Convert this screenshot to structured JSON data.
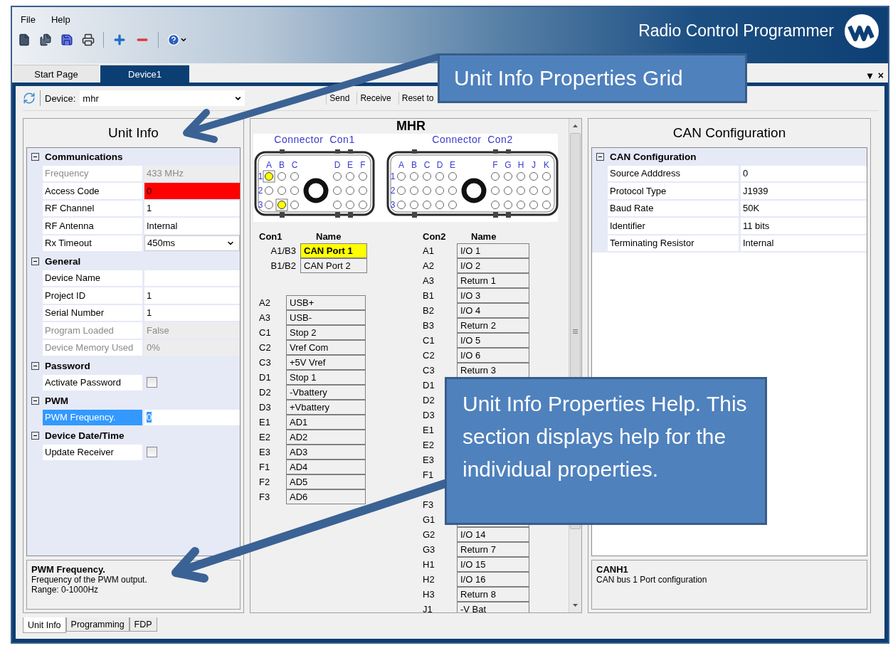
{
  "menu": [
    {
      "label": "File"
    },
    {
      "label": "Help"
    }
  ],
  "app_title": "Radio Control Programmer",
  "document_tabs": [
    {
      "label": "Start Page",
      "selected": false
    },
    {
      "label": "Device1",
      "selected": true
    }
  ],
  "tab_controls": [
    "▾",
    "×"
  ],
  "device_toolbar": {
    "label": "Device:",
    "value": "mhr",
    "buttons": [
      "Send",
      "Receive",
      "Reset to"
    ]
  },
  "unit_info": {
    "title": "Unit Info",
    "sections": [
      {
        "title": "Communications",
        "expanded": true,
        "items": [
          {
            "label": "Frequency",
            "value": "433 MHz",
            "kind": "text",
            "disabled": true,
            "error": false,
            "selected": false
          },
          {
            "label": "Access Code",
            "value": "0",
            "kind": "text",
            "disabled": false,
            "error": true,
            "selected": false
          },
          {
            "label": "RF Channel",
            "value": "1",
            "kind": "text",
            "disabled": false,
            "error": false,
            "selected": false
          },
          {
            "label": "RF Antenna",
            "value": "Internal",
            "kind": "text",
            "disabled": false,
            "error": false,
            "selected": false
          },
          {
            "label": "Rx Timeout",
            "value": "450ms",
            "kind": "dropdown",
            "disabled": false,
            "error": false,
            "selected": false
          }
        ]
      },
      {
        "title": "General",
        "expanded": true,
        "items": [
          {
            "label": "Device Name",
            "kind": "text",
            "disabled": false,
            "error": false,
            "selected": false
          },
          {
            "label": "Project ID",
            "value": "1",
            "kind": "text",
            "disabled": false,
            "error": false,
            "selected": false
          },
          {
            "label": "Serial Number",
            "value": "1",
            "kind": "text",
            "disabled": false,
            "error": false,
            "selected": false
          },
          {
            "label": "Program Loaded",
            "value": "False",
            "kind": "text",
            "disabled": true,
            "error": false,
            "selected": false
          },
          {
            "label": "Device Memory Used",
            "value": "0%",
            "kind": "text",
            "disabled": true,
            "error": false,
            "selected": false
          }
        ]
      },
      {
        "title": "Password",
        "expanded": true,
        "items": [
          {
            "label": "Activate Password",
            "kind": "checkbox",
            "checked": false,
            "disabled": false,
            "error": false,
            "selected": false
          }
        ]
      },
      {
        "title": "PWM",
        "expanded": true,
        "items": [
          {
            "label": "PWM Frequency.",
            "value": "0",
            "kind": "text",
            "disabled": false,
            "error": false,
            "selected": true
          }
        ]
      },
      {
        "title": "Device Date/Time",
        "expanded": true,
        "items": [
          {
            "label": "Update Receiver",
            "kind": "checkbox",
            "checked": false,
            "disabled": false,
            "error": false,
            "selected": false
          }
        ]
      }
    ],
    "help": {
      "title": "PWM Frequency.",
      "lines": [
        "Frequency of the PWM output.",
        "Range: 0-1000Hz"
      ]
    }
  },
  "mhr": {
    "title": "MHR",
    "connectors": [
      {
        "title": "Connector  Con1",
        "columns_left": [
          "A",
          "B",
          "C"
        ],
        "columns_right": [
          "D",
          "E",
          "F"
        ],
        "rows": [
          {
            "label": "1",
            "pins": [
              true,
              false,
              false,
              false,
              false,
              false
            ]
          },
          {
            "label": "2",
            "pins": [
              false,
              false,
              false,
              false,
              false,
              false
            ]
          },
          {
            "label": "3",
            "pins": [
              false,
              true,
              false,
              false,
              false,
              false
            ]
          }
        ]
      },
      {
        "title": "Connector  Con2",
        "columns_left": [
          "A",
          "B",
          "C",
          "D",
          "E"
        ],
        "columns_right": [
          "F",
          "G",
          "H",
          "J",
          "K"
        ],
        "rows": [
          {
            "label": "1",
            "pins": [
              false,
              false,
              false,
              false,
              false,
              false,
              false,
              false,
              false,
              false
            ]
          },
          {
            "label": "2",
            "pins": [
              false,
              false,
              false,
              false,
              false,
              false,
              false,
              false,
              false,
              false
            ]
          },
          {
            "label": "3",
            "pins": [
              false,
              false,
              false,
              false,
              false,
              false,
              false,
              false,
              false,
              false
            ]
          }
        ]
      }
    ],
    "con1": {
      "headers": [
        "Con1",
        "Name"
      ],
      "groups": [
        [
          {
            "pin": "A1/B3",
            "name": "CAN Port 1",
            "highlighted": true
          },
          {
            "pin": "B1/B2",
            "name": "CAN Port 2",
            "highlighted": false
          }
        ],
        [
          {
            "pin": "A2",
            "name": "USB+",
            "highlighted": false
          },
          {
            "pin": "A3",
            "name": "USB-",
            "highlighted": false
          },
          {
            "pin": "C1",
            "name": "Stop 2",
            "highlighted": false
          },
          {
            "pin": "C2",
            "name": "Vref Com",
            "highlighted": false
          },
          {
            "pin": "C3",
            "name": "+5V Vref",
            "highlighted": false
          },
          {
            "pin": "D1",
            "name": "Stop 1",
            "highlighted": false
          },
          {
            "pin": "D2",
            "name": "-Vbattery",
            "highlighted": false
          },
          {
            "pin": "D3",
            "name": "+Vbattery",
            "highlighted": false
          },
          {
            "pin": "E1",
            "name": "AD1",
            "highlighted": false
          },
          {
            "pin": "E2",
            "name": "AD2",
            "highlighted": false
          },
          {
            "pin": "E3",
            "name": "AD3",
            "highlighted": false
          },
          {
            "pin": "F1",
            "name": "AD4",
            "highlighted": false
          },
          {
            "pin": "F2",
            "name": "AD5",
            "highlighted": false
          },
          {
            "pin": "F3",
            "name": "AD6",
            "highlighted": false
          }
        ]
      ]
    },
    "con2": {
      "headers": [
        "Con2",
        "Name"
      ],
      "rows": [
        {
          "pin": "A1",
          "name": "I/O 1"
        },
        {
          "pin": "A2",
          "name": "I/O 2"
        },
        {
          "pin": "A3",
          "name": "Return 1"
        },
        {
          "pin": "B1",
          "name": "I/O 3"
        },
        {
          "pin": "B2",
          "name": "I/O 4"
        },
        {
          "pin": "B3",
          "name": "Return 2"
        },
        {
          "pin": "C1",
          "name": "I/O 5"
        },
        {
          "pin": "C2",
          "name": "I/O 6"
        },
        {
          "pin": "C3",
          "name": "Return 3"
        },
        {
          "pin": "D1"
        },
        {
          "pin": "D2"
        },
        {
          "pin": "D3"
        },
        {
          "pin": "E1"
        },
        {
          "pin": "E2"
        },
        {
          "pin": "E3"
        },
        {
          "pin": "F1"
        },
        {},
        {
          "pin": "F3"
        },
        {
          "pin": "G1"
        },
        {
          "pin": "G2",
          "name": "I/O 14"
        },
        {
          "pin": "G3",
          "name": "Return 7"
        },
        {
          "pin": "H1",
          "name": "I/O 15"
        },
        {
          "pin": "H2",
          "name": "I/O 16"
        },
        {
          "pin": "H3",
          "name": "Return 8"
        },
        {
          "pin": "J1",
          "name": "-V Bat"
        }
      ]
    }
  },
  "can": {
    "title": "CAN Configuration",
    "sections": [
      {
        "title": "CAN Configuration",
        "expanded": true,
        "items": [
          {
            "label": "Source Adddress",
            "value": "0",
            "kind": "text",
            "disabled": false,
            "error": false,
            "selected": false
          },
          {
            "label": "Protocol Type",
            "value": "J1939",
            "kind": "text",
            "disabled": false,
            "error": false,
            "selected": false
          },
          {
            "label": "Baud Rate",
            "value": "50K",
            "kind": "text",
            "disabled": false,
            "error": false,
            "selected": false
          },
          {
            "label": "Identifier",
            "value": "11 bits",
            "kind": "text",
            "disabled": false,
            "error": false,
            "selected": false
          },
          {
            "label": "Terminating Resistor",
            "value": "Internal",
            "kind": "text",
            "disabled": false,
            "error": false,
            "selected": false
          }
        ]
      }
    ],
    "help": {
      "title": "CANH1",
      "lines": [
        "CAN bus 1 Port configuration"
      ]
    }
  },
  "bottom_tabs": [
    {
      "label": "Unit Info",
      "selected": true
    },
    {
      "label": "Programming",
      "selected": false
    },
    {
      "label": "FDP",
      "selected": false
    }
  ],
  "callouts": [
    {
      "text": "Unit Info Properties Grid"
    },
    {
      "text": "Unit Info Properties Help. This section displays help for the individual properties."
    }
  ]
}
